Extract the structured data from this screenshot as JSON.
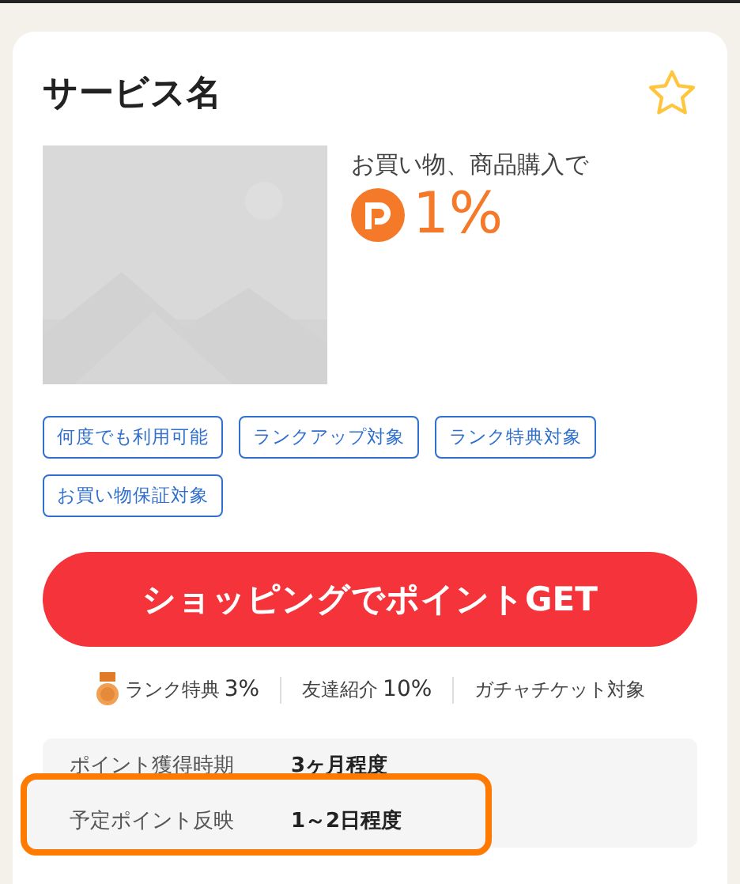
{
  "service": {
    "title": "サービス名",
    "favorite": false,
    "condition": "お買い物、商品購入で",
    "rate": "1%"
  },
  "tags": [
    "何度でも利用可能",
    "ランクアップ対象",
    "ランク特典対象",
    "お買い物保証対象"
  ],
  "cta": "ショッピングでポイントGET",
  "perks": [
    {
      "kind": "medal",
      "label": "ランク特典",
      "value": "3%"
    },
    {
      "kind": "plain",
      "label": "友達紹介",
      "value": "10%"
    },
    {
      "kind": "plain",
      "label": "ガチャチケット対象"
    }
  ],
  "info": [
    {
      "label": "ポイント獲得時期",
      "value": "3ヶ月程度",
      "highlighted": false
    },
    {
      "label": "予定ポイント反映",
      "value": "1～2日程度",
      "highlighted": true
    }
  ]
}
